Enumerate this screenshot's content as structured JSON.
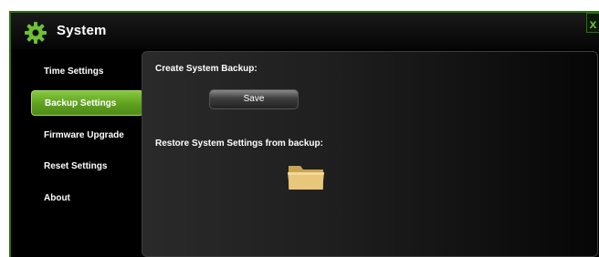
{
  "window": {
    "title": "System",
    "close_label": "x"
  },
  "sidebar": {
    "items": [
      {
        "label": "Time Settings",
        "active": false
      },
      {
        "label": "Backup Settings",
        "active": true
      },
      {
        "label": "Firmware Upgrade",
        "active": false
      },
      {
        "label": "Reset Settings",
        "active": false
      },
      {
        "label": "About",
        "active": false
      }
    ]
  },
  "main": {
    "backup_label": "Create System Backup:",
    "save_label": "Save",
    "restore_label": "Restore System Settings from backup:"
  },
  "icons": {
    "settings": "gear-icon",
    "restore": "folder-icon",
    "close": "close-icon"
  },
  "colors": {
    "accent": "#6fbf35",
    "active_item": "#5fa01f",
    "border": "#2f6e13",
    "folder": "#e8c77a"
  }
}
